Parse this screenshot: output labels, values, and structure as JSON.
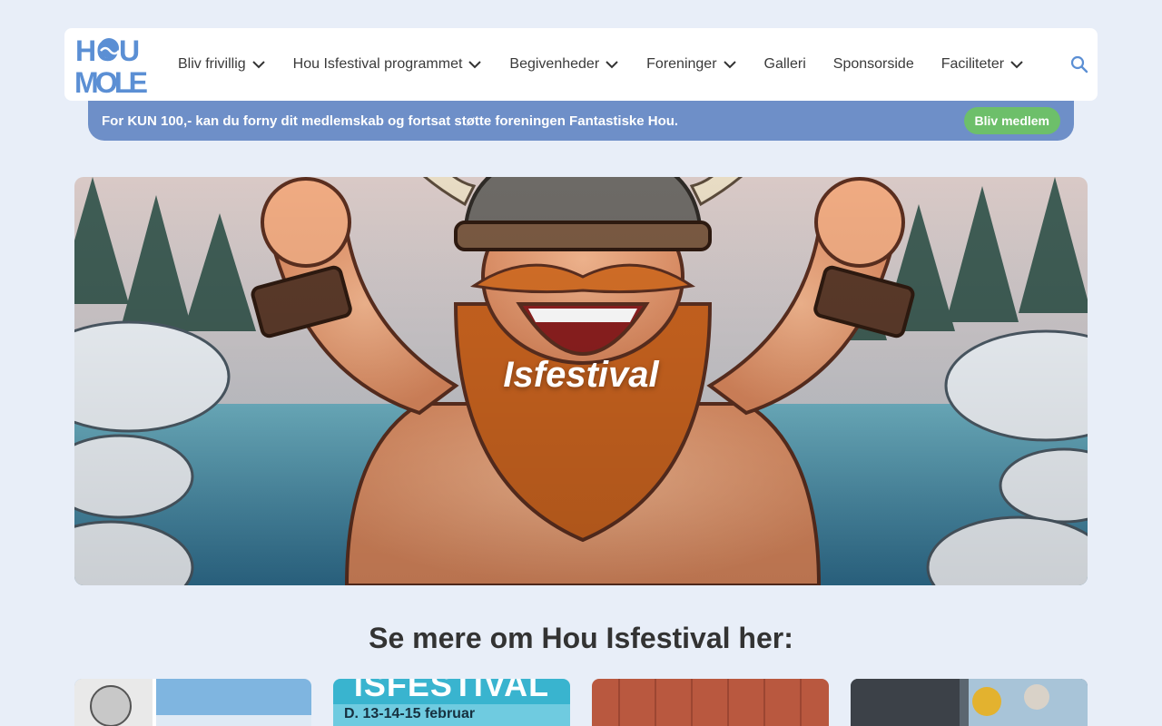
{
  "header": {
    "logo_text_top": "HOU",
    "logo_text_bottom": "MOLE",
    "nav": [
      {
        "label": "Bliv frivillig",
        "has_dropdown": true
      },
      {
        "label": "Hou Isfestival programmet",
        "has_dropdown": true
      },
      {
        "label": "Begivenheder",
        "has_dropdown": true
      },
      {
        "label": "Foreninger",
        "has_dropdown": true
      },
      {
        "label": "Galleri",
        "has_dropdown": false
      },
      {
        "label": "Sponsorside",
        "has_dropdown": false
      },
      {
        "label": "Faciliteter",
        "has_dropdown": true
      }
    ],
    "search_icon": "search-icon"
  },
  "banner": {
    "text": "For KUN 100,- kan du forny dit medlemskab og fortsat støtte foreningen Fantastiske Hou.",
    "button_label": "Bliv medlem"
  },
  "hero": {
    "title": "Isfestival"
  },
  "section": {
    "title": "Se mere om Hou Isfestival her:"
  },
  "cards": [
    {
      "top_text": "",
      "caption": ""
    },
    {
      "top_text": "ISFESTIVAL",
      "caption": "D. 13-14-15 februar"
    },
    {
      "top_text": "",
      "caption": ""
    },
    {
      "top_text": "",
      "caption": ""
    }
  ],
  "colors": {
    "page_bg": "#e8eef8",
    "banner_bg": "#6e8fc8",
    "button_green": "#6dbf6a",
    "logo_blue": "#5b8fd4"
  }
}
